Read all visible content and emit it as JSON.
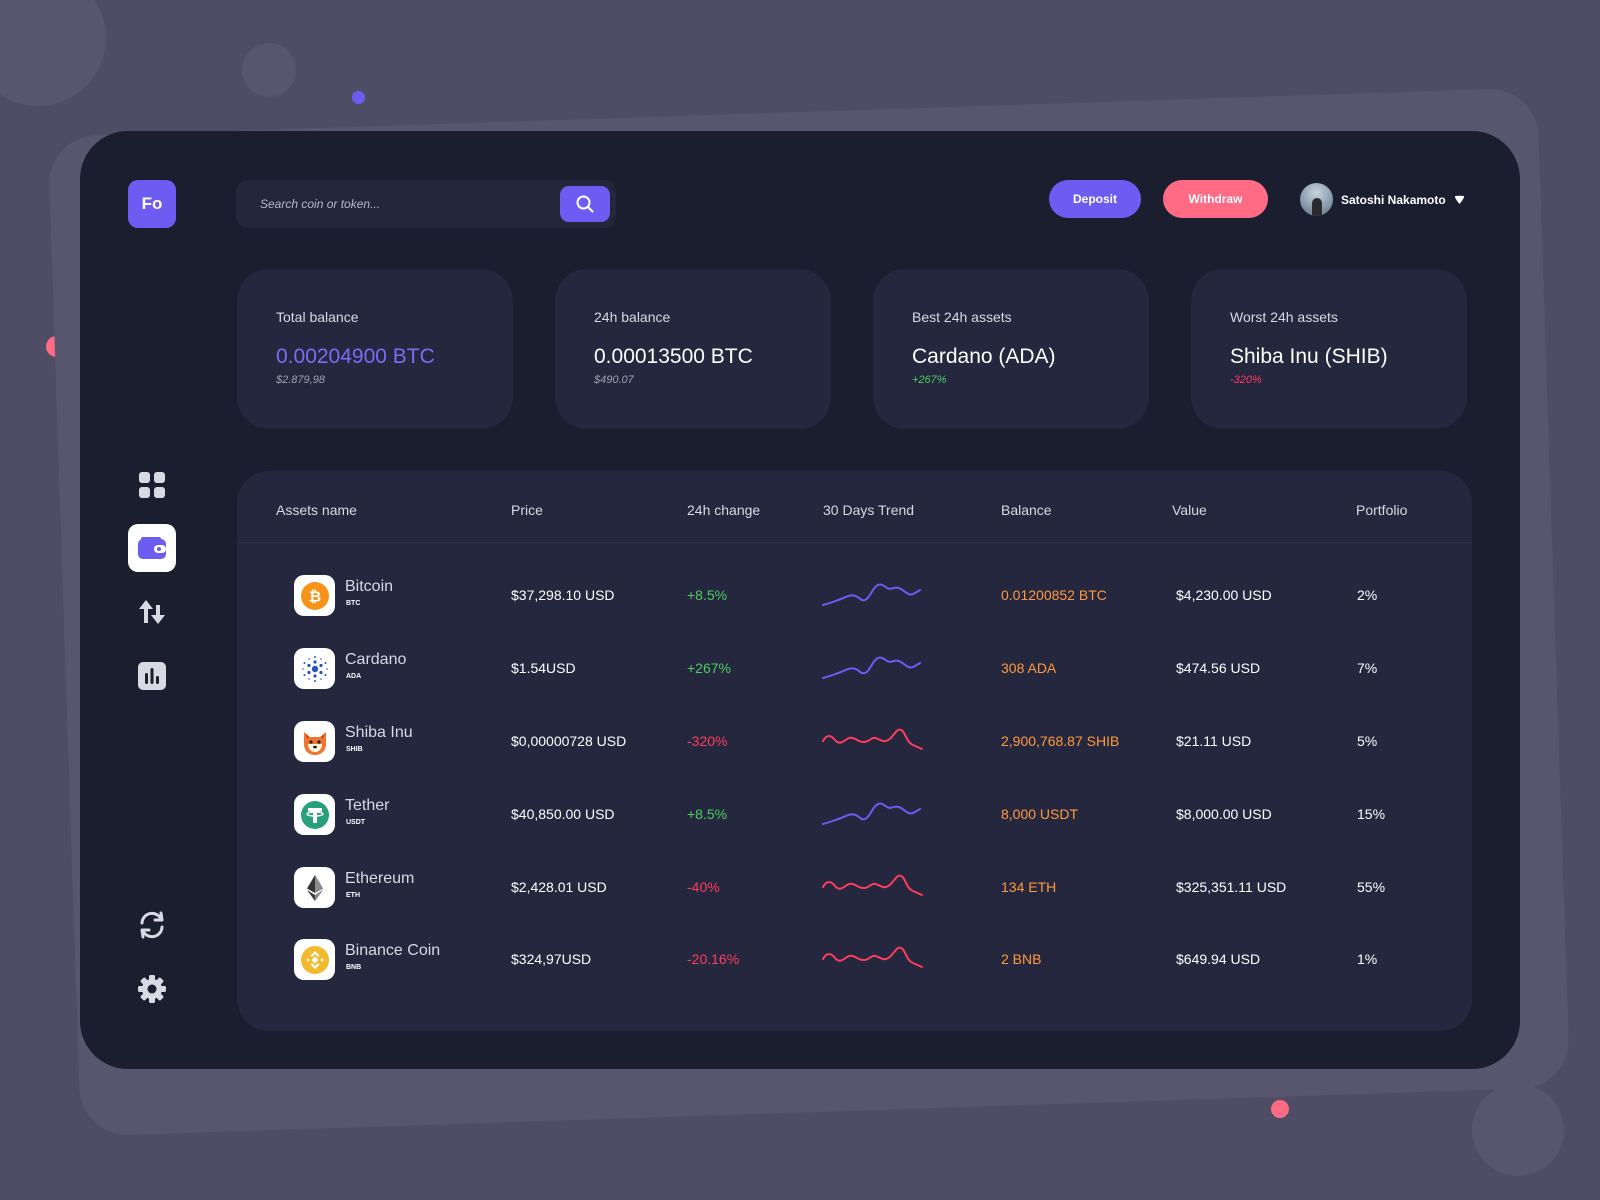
{
  "app": {
    "logo_text": "Fo"
  },
  "header": {
    "search_placeholder": "Search coin or token...",
    "deposit_label": "Deposit",
    "withdraw_label": "Withdraw",
    "user_name": "Satoshi Nakamoto"
  },
  "sidebar": {
    "items": [
      {
        "name": "dashboard",
        "icon": "grid-icon",
        "active": false
      },
      {
        "name": "wallet",
        "icon": "wallet-icon",
        "active": true
      },
      {
        "name": "exchange",
        "icon": "swap-arrows-icon",
        "active": false
      },
      {
        "name": "stats",
        "icon": "bar-chart-icon",
        "active": false
      }
    ],
    "bottom": [
      {
        "name": "sync",
        "icon": "refresh-icon"
      },
      {
        "name": "settings",
        "icon": "gear-icon"
      }
    ]
  },
  "stats": [
    {
      "label": "Total balance",
      "value": "0.00204900 BTC",
      "sub": "$2.879,98"
    },
    {
      "label": "24h balance",
      "value": "0.00013500 BTC",
      "sub": "$490.07"
    },
    {
      "label": "Best 24h assets",
      "value": "Cardano (ADA)",
      "sub": "+267%"
    },
    {
      "label": "Worst 24h assets",
      "value": "Shiba Inu (SHIB)",
      "sub": "-320%"
    }
  ],
  "table": {
    "headers": {
      "asset": "Assets name",
      "price": "Price",
      "change": "24h change",
      "trend": "30 Days Trend",
      "balance": "Balance",
      "value": "Value",
      "portfolio": "Portfolio"
    },
    "rows": [
      {
        "name": "Bitcoin",
        "symbol": "BTC",
        "price": "$37,298.10 USD",
        "change": "+8.5%",
        "trend": "up",
        "balance": "0.01200852 BTC",
        "value": "$4,230.00 USD",
        "portfolio": "2%"
      },
      {
        "name": "Cardano",
        "symbol": "ADA",
        "price": "$1.54USD",
        "change": "+267%",
        "trend": "up",
        "balance": "308 ADA",
        "value": "$474.56 USD",
        "portfolio": "7%"
      },
      {
        "name": "Shiba Inu",
        "symbol": "SHIB",
        "price": "$0,00000728 USD",
        "change": "-320%",
        "trend": "down",
        "balance": "2,900,768.87 SHIB",
        "value": "$21.11 USD",
        "portfolio": "5%"
      },
      {
        "name": "Tether",
        "symbol": "USDT",
        "price": "$40,850.00 USD",
        "change": "+8.5%",
        "trend": "up",
        "balance": "8,000 USDT",
        "value": "$8,000.00 USD",
        "portfolio": "15%"
      },
      {
        "name": "Ethereum",
        "symbol": "ETH",
        "price": "$2,428.01 USD",
        "change": "-40%",
        "trend": "down",
        "balance": "134 ETH",
        "value": "$325,351.11 USD",
        "portfolio": "55%"
      },
      {
        "name": "Binance Coin",
        "symbol": "BNB",
        "price": "$324,97USD",
        "change": "-20.16%",
        "trend": "down",
        "balance": "2 BNB",
        "value": "$649.94 USD",
        "portfolio": "1%"
      }
    ]
  },
  "colors": {
    "accent": "#6c5cf2",
    "withdraw": "#ff6a84",
    "positive": "#4ccf5e",
    "negative": "#ff3d5c",
    "balance": "#ff9a3c"
  }
}
